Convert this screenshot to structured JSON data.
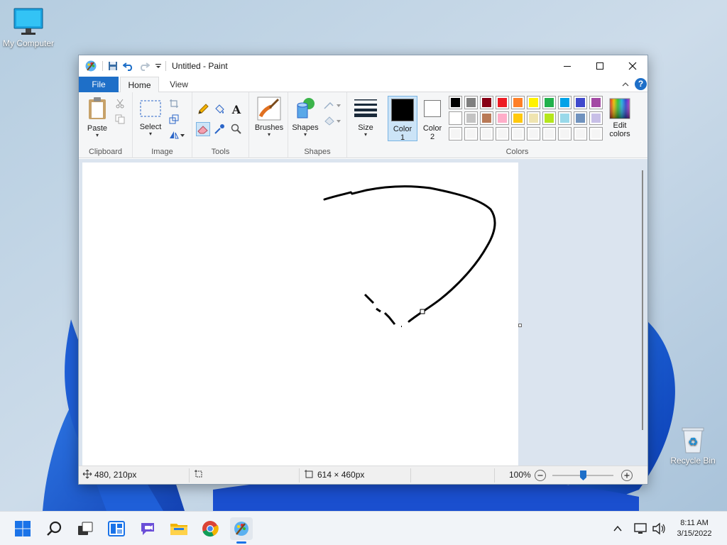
{
  "desktop": {
    "icons": [
      {
        "label": "My Computer"
      },
      {
        "label": "Recycle Bin"
      }
    ]
  },
  "window": {
    "title": "Untitled - Paint",
    "tabs": {
      "file": "File",
      "home": "Home",
      "view": "View"
    }
  },
  "ribbon": {
    "clipboard": {
      "paste": "Paste",
      "group": "Clipboard"
    },
    "image": {
      "select": "Select",
      "group": "Image"
    },
    "tools": {
      "group": "Tools"
    },
    "brushes": {
      "label": "Brushes"
    },
    "shapes": {
      "label": "Shapes",
      "group": "Shapes"
    },
    "size": {
      "label": "Size"
    },
    "colors": {
      "color1_line1": "Color",
      "color1_line2": "1",
      "color2_line1": "Color",
      "color2_line2": "2",
      "edit_line1": "Edit",
      "edit_line2": "colors",
      "group": "Colors",
      "color1_value": "#000000",
      "color2_value": "#ffffff",
      "palette_row1": [
        "#000000",
        "#7f7f7f",
        "#880015",
        "#ed1c24",
        "#ff7f27",
        "#fff200",
        "#22b14c",
        "#00a2e8",
        "#3f48cc",
        "#a349a4"
      ],
      "palette_row2": [
        "#ffffff",
        "#c3c3c3",
        "#b97a57",
        "#ffaec9",
        "#ffc90e",
        "#efe4b0",
        "#b5e61d",
        "#99d9ea",
        "#7092be",
        "#c8bfe7"
      ],
      "palette_row3": [
        "#f5f5f5",
        "#f5f5f5",
        "#f5f5f5",
        "#f5f5f5",
        "#f5f5f5",
        "#f5f5f5",
        "#f5f5f5",
        "#f5f5f5",
        "#f5f5f5",
        "#f5f5f5"
      ]
    }
  },
  "status": {
    "cursor_pos": "480, 210px",
    "selection_size": "",
    "image_size": "614 × 460px",
    "zoom": "100%",
    "zoom_level": 1.0
  },
  "taskbar": {
    "time": "8:11 AM",
    "date": "3/15/2022"
  }
}
